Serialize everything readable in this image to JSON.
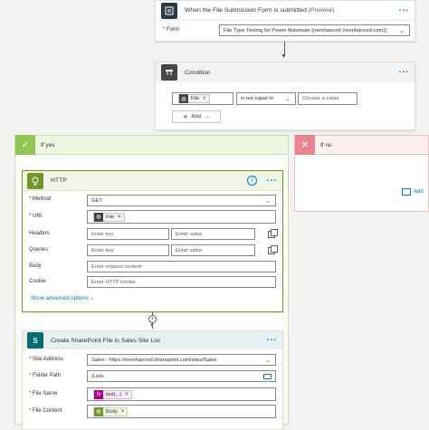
{
  "trigger": {
    "title": "When the File Submission Form is submitted",
    "preview": "(Preview)",
    "form_label": "Form",
    "form_value": "File Type Testing for Power Automate [reenhanced (reenhanced.com)]"
  },
  "condition": {
    "title": "Condition",
    "token": "File",
    "operator": "is not equal to",
    "value_placeholder": "Choose a value",
    "add_label": "Add"
  },
  "if_yes": {
    "label": "If yes"
  },
  "if_no": {
    "label": "If no",
    "add_action_label": "Add"
  },
  "http": {
    "title": "HTTP",
    "method_label": "Method",
    "method_value": "GET",
    "uri_label": "URI",
    "uri_token": "File",
    "headers_label": "Headers",
    "queries_label": "Queries",
    "key_placeholder": "Enter key",
    "value_placeholder": "Enter value",
    "body_label": "Body",
    "body_placeholder": "Enter request content",
    "cookie_label": "Cookie",
    "cookie_placeholder": "Enter HTTP cookie",
    "advanced_label": "Show advanced options"
  },
  "sharepoint": {
    "title": "Create SharePoint File in Sales Site List",
    "site_label": "Site Address",
    "site_value": "Sales - https://reenhanced.sharepoint.com/sites/Sales",
    "folder_label": "Folder Path",
    "folder_value": "/Lists",
    "name_label": "File Name",
    "name_token": "last(...)",
    "content_label": "File Content",
    "content_token": "Body"
  },
  "colors": {
    "trigger_icon": "#2b3a4a",
    "http_green": "#709727",
    "sharepoint_teal": "#036c70",
    "accent": "#0078d4",
    "yes_green": "#92c353",
    "no_red": "#e8868d"
  }
}
